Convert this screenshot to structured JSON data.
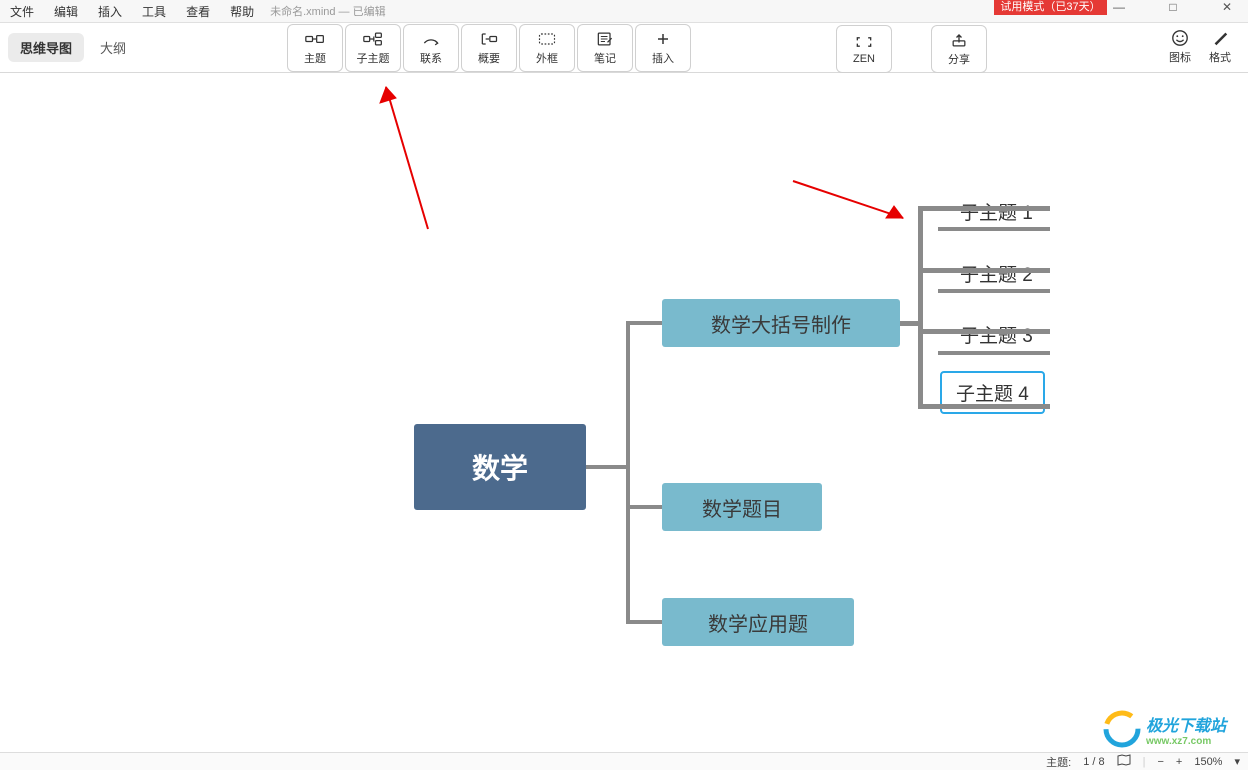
{
  "menubar": {
    "items": [
      "文件",
      "编辑",
      "插入",
      "工具",
      "查看",
      "帮助"
    ],
    "doc_title": "未命名.xmind — 已编辑"
  },
  "trial_badge": "试用模式（已37天）",
  "win": {
    "min": "—",
    "max": "□",
    "close": "✕"
  },
  "view_switch": {
    "mindmap": "思维导图",
    "outline": "大纲"
  },
  "toolbar": {
    "topic": {
      "label": "主题"
    },
    "subtopic": {
      "label": "子主题"
    },
    "relation": {
      "label": "联系"
    },
    "summary": {
      "label": "概要"
    },
    "boundary": {
      "label": "外框"
    },
    "note": {
      "label": "笔记"
    },
    "insert": {
      "label": "插入"
    },
    "zen": {
      "label": "ZEN"
    },
    "share": {
      "label": "分享"
    }
  },
  "right_tools": {
    "marker": "图标",
    "format": "格式"
  },
  "mindmap": {
    "root": "数学",
    "branches": [
      {
        "label": "数学大括号制作",
        "subs": [
          "子主题 1",
          "子主题 2",
          "子主题 3",
          "子主题 4"
        ],
        "selected_sub_index": 3
      },
      {
        "label": "数学题目"
      },
      {
        "label": "数学应用题"
      }
    ]
  },
  "statusbar": {
    "topic_count_label": "主题:",
    "topic_count": "1 / 8",
    "zoom": "150%"
  },
  "watermark": {
    "title": "极光下载站",
    "url": "www.xz7.com"
  }
}
